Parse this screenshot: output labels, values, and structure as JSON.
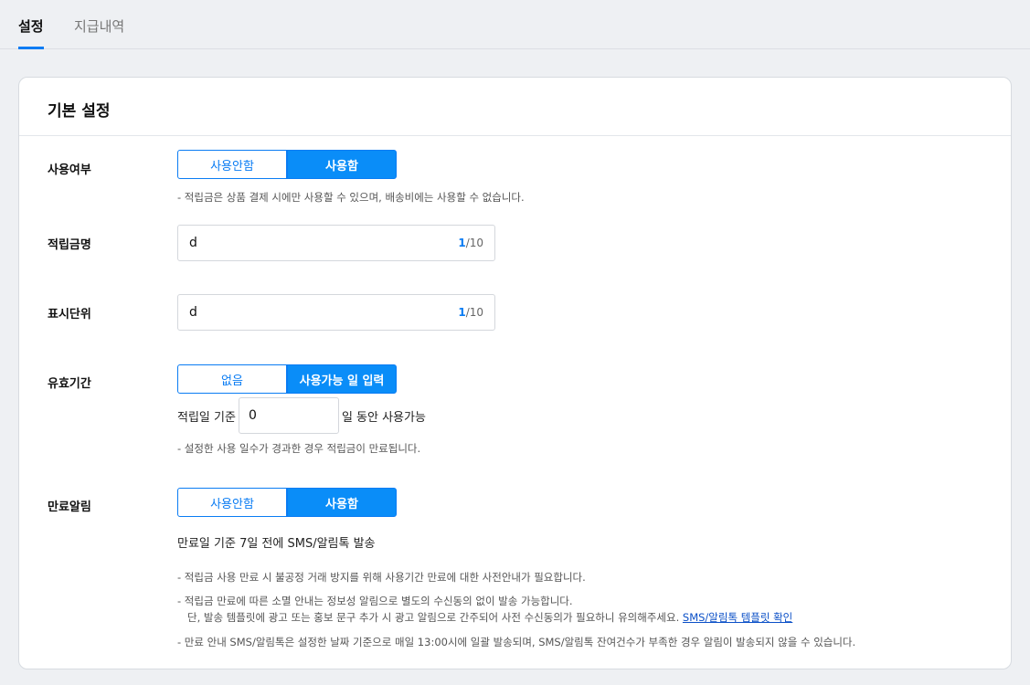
{
  "tabs": [
    {
      "label": "설정"
    },
    {
      "label": "지급내역"
    }
  ],
  "card": {
    "title": "기본 설정",
    "usage": {
      "label": "사용여부",
      "options": [
        "사용안함",
        "사용함"
      ],
      "note": "-  적립금은 상품 결제 시에만 사용할 수 있으며, 배송비에는 사용할 수 없습니다."
    },
    "name": {
      "label": "적립금명",
      "value": "d",
      "count": "1",
      "max": "/10"
    },
    "unit": {
      "label": "표시단위",
      "value": "d",
      "count": "1",
      "max": "/10"
    },
    "validity": {
      "label": "유효기간",
      "options": [
        "없음",
        "사용가능 일 입력"
      ],
      "prefix": "적립일 기준",
      "days": "0",
      "suffix": "일 동안 사용가능",
      "note": "-  설정한 사용 일수가 경과한 경우 적립금이 만료됩니다."
    },
    "expiry": {
      "label": "만료알림",
      "options": [
        "사용안함",
        "사용함"
      ],
      "info": "만료일 기준 7일 전에 SMS/알림톡 발송",
      "note1": "-  적립금 사용 만료 시 불공정 거래 방지를 위해 사용기간 만료에 대한 사전안내가 필요합니다.",
      "note2": "-  적립금 만료에 따른 소멸 안내는 정보성 알림으로 별도의 수신동의 없이 발송 가능합니다.",
      "note3": "단, 발송 템플릿에 광고 또는 홍보 문구 추가 시 광고 알림으로 간주되어 사전 수신동의가 필요하니 유의해주세요.",
      "note3_link": "SMS/알림톡 템플릿 확인",
      "note4": "-  만료 안내 SMS/알림톡은 설정한 날짜 기준으로 매일 13:00시에 일괄 발송되며, SMS/알림톡 잔여건수가 부족한 경우 알림이 발송되지 않을 수 있습니다."
    }
  }
}
